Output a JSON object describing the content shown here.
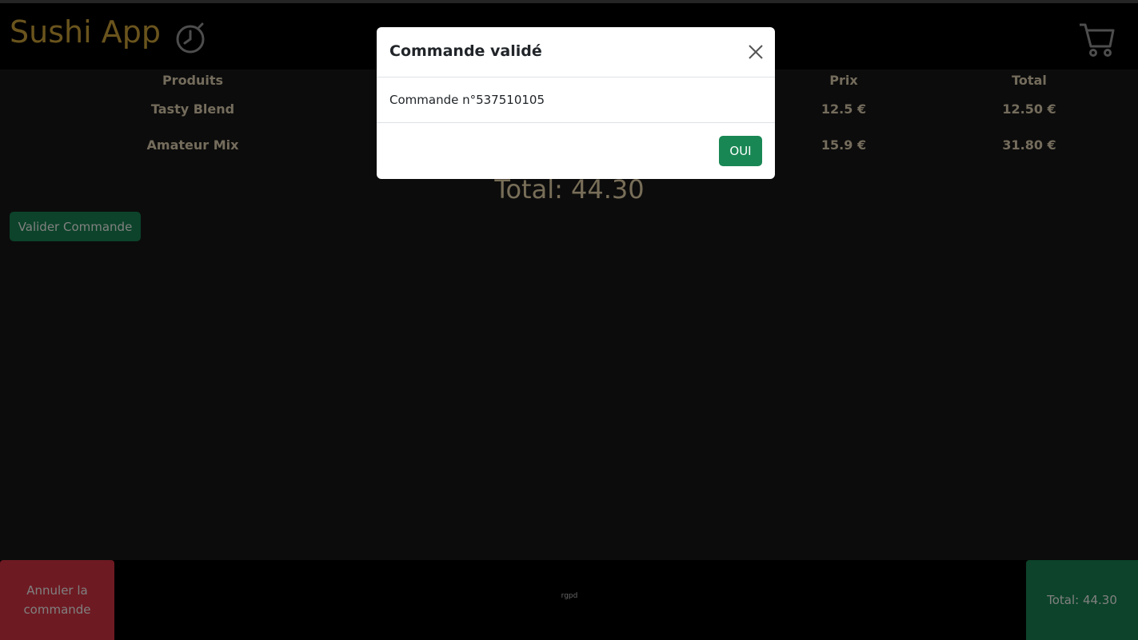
{
  "header": {
    "brand": "Sushi App",
    "timer_icon": "stopwatch-icon",
    "cart_icon": "cart-icon"
  },
  "table": {
    "headers": [
      "Produits",
      "Prix",
      "Total"
    ],
    "rows": [
      {
        "product": "Tasty Blend",
        "price": "12.5 €",
        "total": "12.50 €"
      },
      {
        "product": "Amateur Mix",
        "price": "15.9 €",
        "total": "31.80 €"
      }
    ]
  },
  "total_text": "Total: 44.30",
  "valider_label": "Valider Commande",
  "footer": {
    "cancel_label": "Annuler la commande",
    "rgpd": "rgpd",
    "total_label": "Total: 44.30"
  },
  "modal": {
    "title": "Commande validé",
    "body": "Commande n°537510105",
    "confirm_label": "OUI",
    "close_icon": "close-icon"
  },
  "colors": {
    "brand": "#d4a83a",
    "success": "#198754",
    "danger": "#dc3545",
    "header_bg": "#000000",
    "page_bg": "#181818"
  }
}
